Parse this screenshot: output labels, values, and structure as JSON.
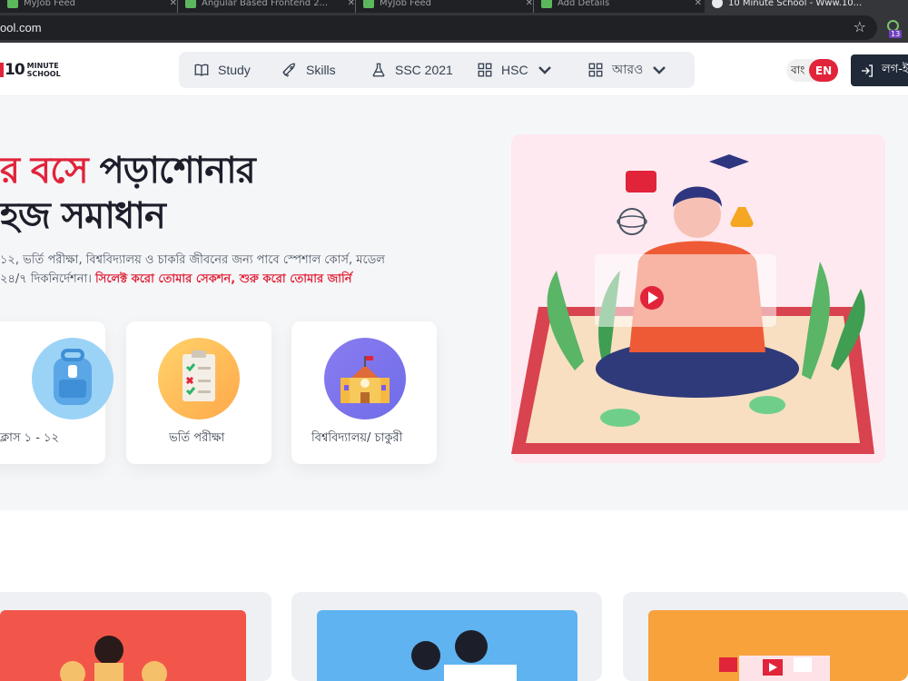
{
  "browser": {
    "tabs": [
      {
        "title": "MyJob Feed"
      },
      {
        "title": "Angular Based Frontend 2..."
      },
      {
        "title": "MyJob Feed"
      },
      {
        "title": "Add Details"
      },
      {
        "title": "10 Minute School - Www.10..."
      }
    ],
    "url": "ool.com",
    "extension_badge": "13"
  },
  "header": {
    "logo_number": "10",
    "logo_line1": "MINUTE",
    "logo_line2": "SCHOOL",
    "nav": [
      {
        "label": "Study",
        "icon": "book-icon"
      },
      {
        "label": "Skills",
        "icon": "rocket-icon"
      },
      {
        "label": "SSC 2021",
        "icon": "flask-icon"
      },
      {
        "label": "HSC",
        "icon": "grid-icon"
      },
      {
        "label": "আরও",
        "icon": "grid-icon"
      }
    ],
    "lang_bn": "বাং",
    "lang_en": "EN",
    "login_label": "লগ-ইন"
  },
  "hero": {
    "title_red": "র বসে",
    "title_dark": " পড়াশোনার",
    "title_line2": "হজ সমাধান",
    "desc_line1": "১২, ভর্তি পরীক্ষা, বিশ্ববিদ্যালয় ও চাকরি জীবনের জন্য পাবে স্পেশাল কোর্স, মডেল",
    "desc_line2_plain": "২৪/৭ দিকনির্দেশনা। ",
    "desc_line2_red": "সিলেক্ট করো তোমার সেকশন, শুরু করো তোমার জার্নি",
    "categories": [
      {
        "label": "ক্লাস ১ - ১২"
      },
      {
        "label": "ভর্তি পরীক্ষা"
      },
      {
        "label": "বিশ্ববিদ্যালয়/ চাকুরী"
      }
    ]
  },
  "colors": {
    "brand_red": "#e1243a",
    "dark": "#1c1f2a"
  }
}
